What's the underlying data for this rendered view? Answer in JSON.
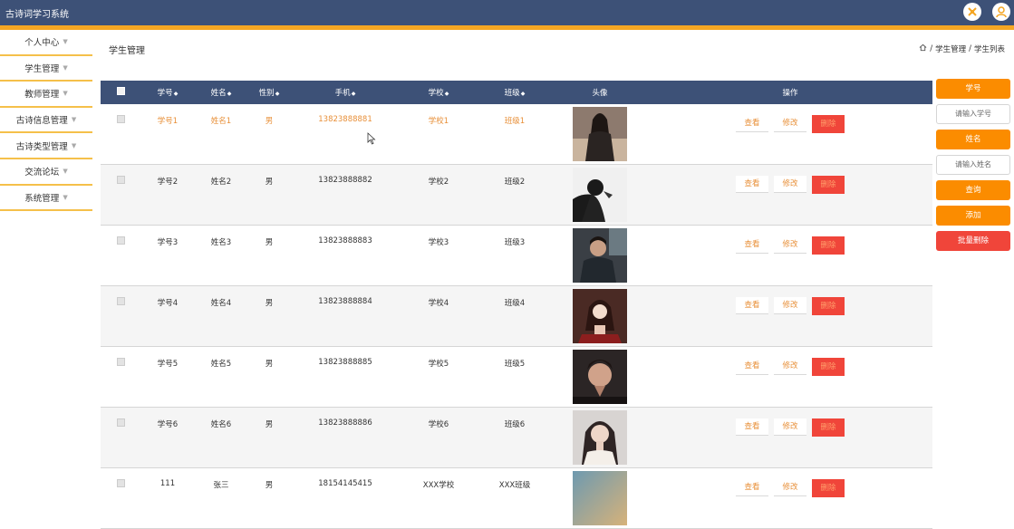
{
  "app": {
    "title": "古诗词学习系统"
  },
  "header_icons": [
    {
      "icon": "fullscreen-icon"
    },
    {
      "icon": "user-icon"
    }
  ],
  "sidebar": {
    "items": [
      {
        "label": "个人中心"
      },
      {
        "label": "学生管理"
      },
      {
        "label": "教师管理"
      },
      {
        "label": "古诗信息管理"
      },
      {
        "label": "古诗类型管理"
      },
      {
        "label": "交流论坛"
      },
      {
        "label": "系统管理"
      }
    ]
  },
  "page": {
    "title": "学生管理"
  },
  "breadcrumb": {
    "home_icon": "home-icon",
    "items": [
      "学生管理",
      "学生列表"
    ],
    "separator": "/"
  },
  "table": {
    "columns": [
      "学号",
      "姓名",
      "性别",
      "手机",
      "学校",
      "班级",
      "头像",
      "操作"
    ],
    "rows": [
      {
        "id": "学号1",
        "name": "姓名1",
        "gender": "男",
        "phone": "13823888881",
        "school": "学校1",
        "class": "班级1"
      },
      {
        "id": "学号2",
        "name": "姓名2",
        "gender": "男",
        "phone": "13823888882",
        "school": "学校2",
        "class": "班级2"
      },
      {
        "id": "学号3",
        "name": "姓名3",
        "gender": "男",
        "phone": "13823888883",
        "school": "学校3",
        "class": "班级3"
      },
      {
        "id": "学号4",
        "name": "姓名4",
        "gender": "男",
        "phone": "13823888884",
        "school": "学校4",
        "class": "班级4"
      },
      {
        "id": "学号5",
        "name": "姓名5",
        "gender": "男",
        "phone": "13823888885",
        "school": "学校5",
        "class": "班级5"
      },
      {
        "id": "学号6",
        "name": "姓名6",
        "gender": "男",
        "phone": "13823888886",
        "school": "学校6",
        "class": "班级6"
      },
      {
        "id": "111",
        "name": "张三",
        "gender": "男",
        "phone": "18154145415",
        "school": "XXX学校",
        "class": "XXX班级"
      }
    ],
    "actions": {
      "view": "查看",
      "edit": "修改",
      "delete": "删除"
    }
  },
  "search_panel": {
    "id_label": "学号",
    "id_placeholder": "请输入学号",
    "name_label": "姓名",
    "name_placeholder": "请输入姓名",
    "query_button": "查询",
    "add_button": "添加",
    "batch_delete_button": "批量删除"
  },
  "colors": {
    "header": "#3d5177",
    "accent": "#f5a623",
    "orange": "#fb8c00",
    "danger": "#f0453a"
  }
}
